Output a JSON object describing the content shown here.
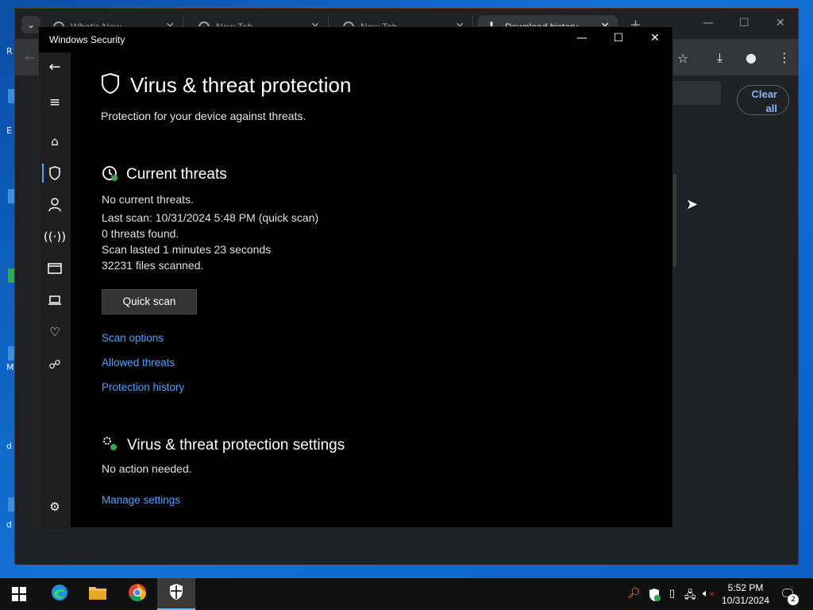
{
  "desktop": {
    "fragments": [
      "R",
      "E",
      "M",
      "d",
      "d"
    ]
  },
  "chrome": {
    "tab_search_icon": "chevron-down-icon",
    "tabs": [
      {
        "label": "What's New"
      },
      {
        "label": "New Tab"
      },
      {
        "label": "New Tab"
      },
      {
        "label": "Download history"
      }
    ],
    "new_tab_glyph": "+",
    "clear_all_label": "Clear all"
  },
  "security": {
    "window_title": "Windows Security",
    "page_title": "Virus & threat protection",
    "subtitle": "Protection for your device against threats.",
    "current_threats": {
      "heading": "Current threats",
      "lines": [
        "No current threats.",
        "Last scan: 10/31/2024 5:48 PM (quick scan)",
        "0 threats found.",
        "Scan lasted 1 minutes 23 seconds",
        "32231 files scanned."
      ],
      "button": "Quick scan",
      "links": [
        "Scan options",
        "Allowed threats",
        "Protection history"
      ]
    },
    "settings": {
      "heading": "Virus & threat protection settings",
      "status": "No action needed.",
      "link": "Manage settings"
    },
    "nav_items": [
      "back-arrow-icon",
      "menu-icon",
      "home-icon",
      "shield-icon",
      "account-icon",
      "network-icon",
      "app-browser-icon",
      "device-icon",
      "health-icon",
      "family-icon",
      "settings-icon"
    ]
  },
  "taskbar": {
    "time": "5:52 PM",
    "date": "10/31/2024",
    "notification_count": "2"
  },
  "colors": {
    "accent_link": "#4aa3ff",
    "taskbar": "#101010",
    "nav_bg": "#1f1f1f"
  }
}
